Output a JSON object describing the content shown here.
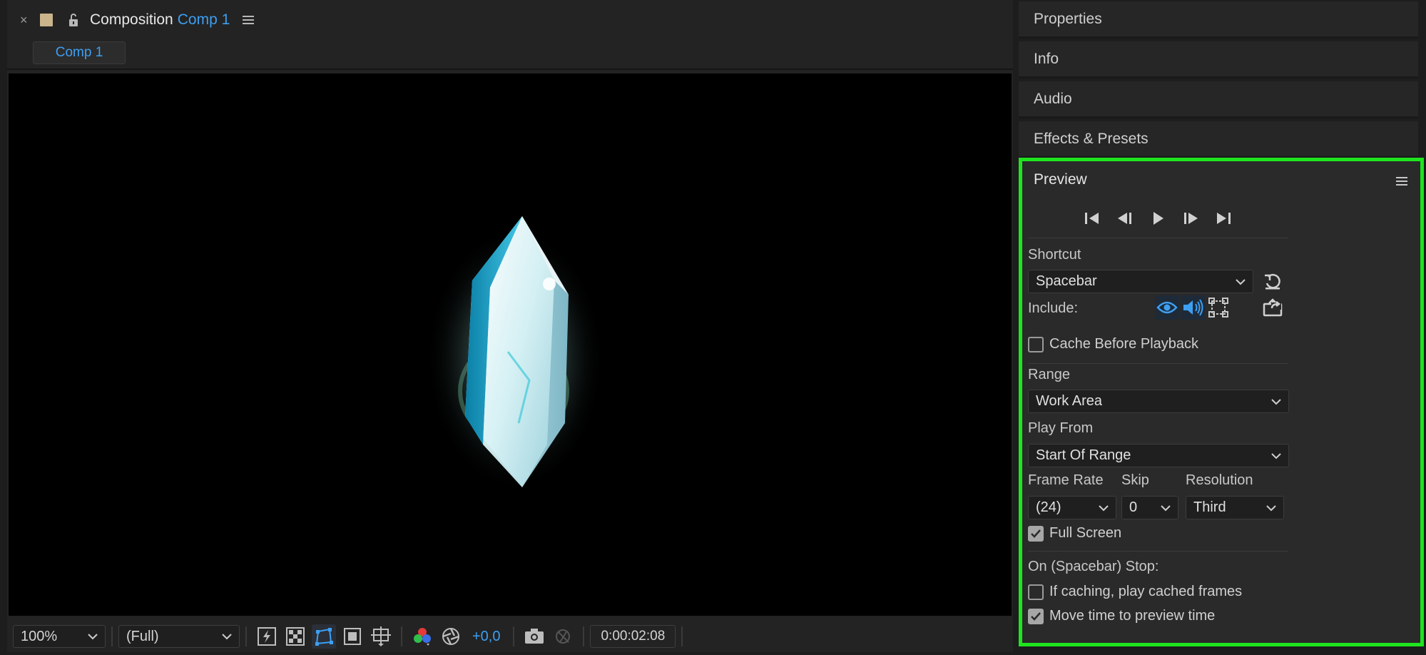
{
  "composition": {
    "close_glyph": "×",
    "title": "Composition",
    "comp_name": "Comp 1",
    "tab": "Comp 1",
    "footer": {
      "zoom": "100%",
      "resolution": "(Full)",
      "exposure": "+0,0",
      "timecode": "0:00:02:08"
    }
  },
  "panels": {
    "properties": "Properties",
    "info": "Info",
    "audio": "Audio",
    "effects": "Effects & Presets"
  },
  "preview": {
    "title": "Preview",
    "shortcut_label": "Shortcut",
    "shortcut_value": "Spacebar",
    "include_label": "Include:",
    "cache_before_playback": {
      "label": "Cache Before Playback",
      "checked": false
    },
    "range_label": "Range",
    "range_value": "Work Area",
    "play_from_label": "Play From",
    "play_from_value": "Start Of Range",
    "frame_rate_label": "Frame Rate",
    "frame_rate_value": "(24)",
    "skip_label": "Skip",
    "skip_value": "0",
    "resolution_label": "Resolution",
    "resolution_value": "Third",
    "full_screen": {
      "label": "Full Screen",
      "checked": true
    },
    "on_stop_label": "On (Spacebar) Stop:",
    "if_caching": {
      "label": "If caching, play cached frames",
      "checked": false
    },
    "move_time": {
      "label": "Move time to preview time",
      "checked": true
    }
  },
  "colors": {
    "accent_blue": "#3d9ff2",
    "highlight_green": "#1ee51e",
    "swatch": "#c9b48c"
  }
}
